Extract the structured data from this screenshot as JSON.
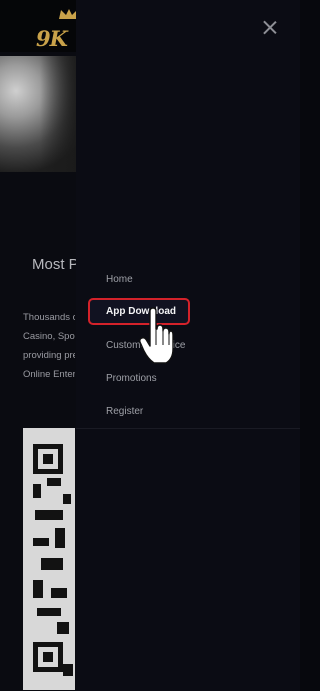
{
  "header": {
    "logo_text": "9K"
  },
  "page": {
    "heading": "Most Popular Online Casino",
    "description_lines": [
      "Thousands of",
      "Casino, Sports,",
      "providing premium",
      "Online Entertainment"
    ]
  },
  "drawer": {
    "items": [
      {
        "label": "Home"
      },
      {
        "label": "App Download",
        "active": true
      },
      {
        "label": "Customer Service"
      },
      {
        "label": "Promotions"
      },
      {
        "label": "Register"
      }
    ]
  },
  "colors": {
    "accent_border": "#d4222a",
    "drawer_bg": "#0b0c14",
    "logo_gold": "#c9a24a"
  }
}
